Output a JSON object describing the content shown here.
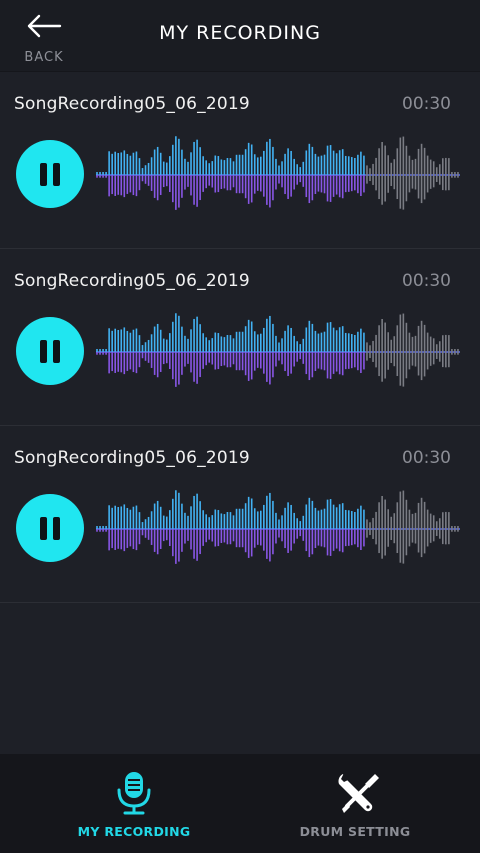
{
  "header": {
    "title": "MY RECORDING",
    "back_label": "BACK"
  },
  "recordings": [
    {
      "name": "SongRecording05_06_2019",
      "duration": "00:30",
      "state": "playing"
    },
    {
      "name": "SongRecording05_06_2019",
      "duration": "00:30",
      "state": "playing"
    },
    {
      "name": "SongRecording05_06_2019",
      "duration": "00:30",
      "state": "playing"
    }
  ],
  "nav": {
    "my_recording_label": "MY RECORDING",
    "drum_setting_label": "DRUM SETTING",
    "active": "my_recording"
  },
  "icons": {
    "back": "arrow-left-icon",
    "pause": "pause-icon",
    "microphone": "microphone-icon",
    "tools": "tools-icon"
  },
  "colors": {
    "accent": "#22d8e6",
    "wave_cyan": "#32e0f5",
    "wave_blue": "#5b6cf0",
    "wave_purple": "#9b4ce0",
    "wave_unplayed": "#7a7c84"
  }
}
